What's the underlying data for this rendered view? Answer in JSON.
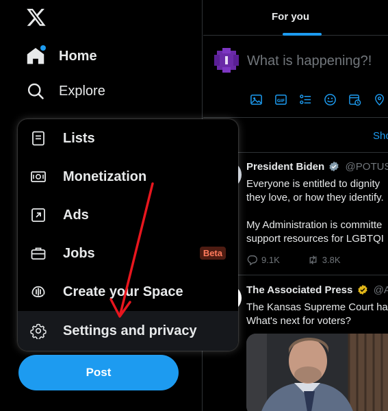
{
  "nav": {
    "home_label": "Home",
    "explore_label": "Explore"
  },
  "menu": {
    "items": [
      {
        "label": "Lists",
        "icon": "lists-icon"
      },
      {
        "label": "Monetization",
        "icon": "money-icon"
      },
      {
        "label": "Ads",
        "icon": "ads-icon"
      },
      {
        "label": "Jobs",
        "icon": "briefcase-icon",
        "badge": "Beta"
      },
      {
        "label": "Create your Space",
        "icon": "spaces-icon"
      },
      {
        "label": "Settings and privacy",
        "icon": "gear-icon"
      }
    ]
  },
  "post_button": "Post",
  "feed": {
    "tab": "For you",
    "composer_placeholder": "What is happening?!",
    "show_more": "Sho",
    "tweets": [
      {
        "name": "President Biden",
        "handle": "@POTUS",
        "lines": [
          "Everyone is entitled to dignity",
          "they love, or how they identify.",
          "",
          "My Administration is committe",
          "support resources for LGBTQI"
        ],
        "replies": "9.1K",
        "reposts": "3.8K"
      },
      {
        "name": "The Associated Press",
        "handle": "@AP",
        "lines": [
          "The Kansas Supreme Court ha",
          "What's next for voters?"
        ]
      }
    ]
  },
  "colors": {
    "accent": "#1d9bf0",
    "annotation_arrow": "#e8161e",
    "beta_bg": "#4e1c12",
    "beta_text": "#ff7a5c"
  }
}
